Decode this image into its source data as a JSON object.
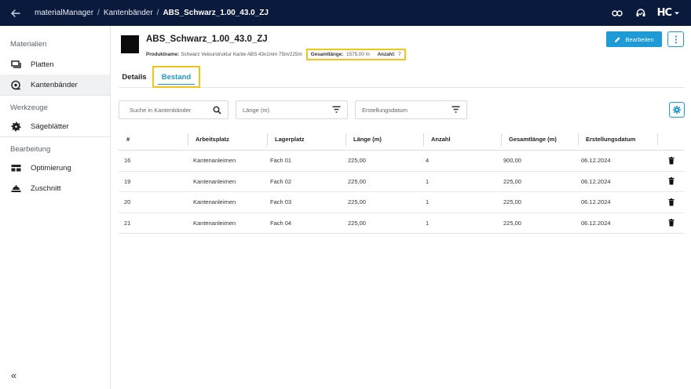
{
  "app": {
    "breadcrumb": [
      "materialManager",
      "Kantenbänder",
      "ABS_Schwarz_1.00_43.0_ZJ"
    ],
    "separator": "/",
    "logo": "HC"
  },
  "sidebar": {
    "sections": [
      {
        "title": "Materialien",
        "items": [
          {
            "label": "Platten",
            "icon": "panel-icon"
          },
          {
            "label": "Kantenbänder",
            "icon": "edge-band-icon",
            "active": true
          }
        ]
      },
      {
        "title": "Werkzeuge",
        "items": [
          {
            "label": "Sägeblätter",
            "icon": "saw-blade-icon"
          }
        ]
      },
      {
        "title": "Bearbeitung",
        "items": [
          {
            "label": "Optimierung",
            "icon": "optimize-icon"
          },
          {
            "label": "Zuschnitt",
            "icon": "cutting-icon"
          }
        ]
      }
    ],
    "collapse_label": "«"
  },
  "header": {
    "title": "ABS_Schwarz_1.00_43.0_ZJ",
    "product_label": "Produktname:",
    "product_value": "Schwarz Velourstruktur Kante ABS 43x1mm 75m/225m",
    "total_label": "Gesamtlänge:",
    "total_value": "1575,00 m",
    "count_label": "Anzahl:",
    "count_value": "7",
    "edit_label": "Bearbeiten"
  },
  "tabs": [
    {
      "label": "Details",
      "active": false
    },
    {
      "label": "Bestand",
      "active": true
    }
  ],
  "filters": {
    "search_placeholder": "Suche in Kantenbänder",
    "length_placeholder": "Länge (m)",
    "date_placeholder": "Erstellungsdatum"
  },
  "table": {
    "columns": [
      "#",
      "Arbeitsplatz",
      "Lagerplatz",
      "Länge (m)",
      "Anzahl",
      "Gesamtlänge (m)",
      "Erstellungsdatum"
    ],
    "rows": [
      [
        "16",
        "Kantenanleimen",
        "Fach 01",
        "225,00",
        "4",
        "900,00",
        "06.12.2024"
      ],
      [
        "19",
        "Kantenanleimen",
        "Fach 02",
        "225,00",
        "1",
        "225,00",
        "06.12.2024"
      ],
      [
        "20",
        "Kantenanleimen",
        "Fach 03",
        "225,00",
        "1",
        "225,00",
        "06.12.2024"
      ],
      [
        "21",
        "Kantenanleimen",
        "Fach 04",
        "225,00",
        "1",
        "225,00",
        "06.12.2024"
      ]
    ]
  },
  "colors": {
    "topbar": "#0a1a3c",
    "accent": "#1e9ad6",
    "highlight": "#f0c419"
  }
}
